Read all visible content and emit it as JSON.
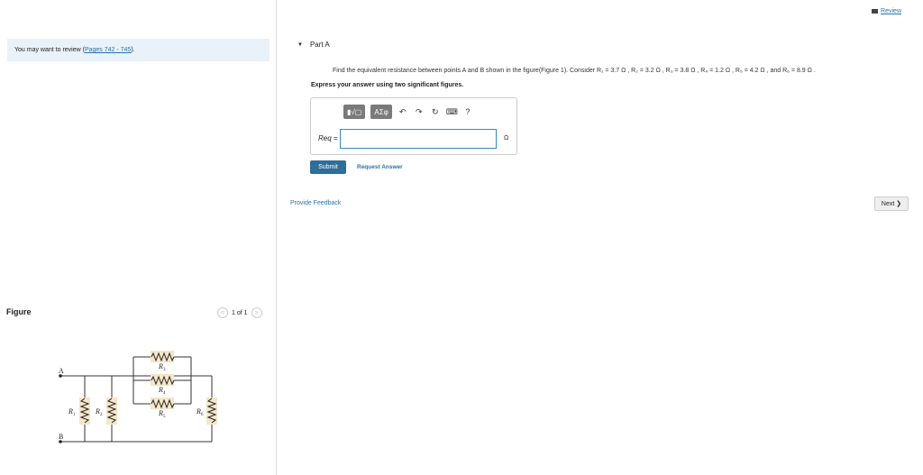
{
  "left": {
    "review_prefix": "You may want to review (",
    "review_link": "Pages 742 - 745",
    "review_suffix": ").",
    "figure_label": "Figure",
    "pager": "1 of 1"
  },
  "circuit": {
    "labels": {
      "a": "A",
      "b": "B",
      "r1": "R",
      "r2": "R",
      "r3": "R",
      "r4": "R",
      "r5": "R",
      "r6": "R",
      "s1": "1",
      "s2": "2",
      "s3": "3",
      "s4": "4",
      "s5": "5",
      "s6": "6"
    }
  },
  "right": {
    "review_link": "Review",
    "part_title": "Part A",
    "question": "Find the equivalent resistance between points A and B shown in the figure(Figure 1). Consider R₁ = 3.7 Ω , R₂ = 3.2 Ω , R₃ = 3.8 Ω , R₄ = 1.2 Ω , R₅ = 4.2 Ω , and R₆ = 8.9 Ω .",
    "instruction": "Express your answer using two significant figures.",
    "toolbar": {
      "templates": "▮√▢",
      "symbols": "ΑΣφ",
      "undo": "↶",
      "redo": "↷",
      "reset": "↻",
      "keyboard": "⌨",
      "help": "?"
    },
    "answer_label": "Req =",
    "answer_value": "",
    "unit": "Ω",
    "submit": "Submit",
    "request": "Request Answer",
    "feedback": "Provide Feedback",
    "next": "Next ❯"
  }
}
